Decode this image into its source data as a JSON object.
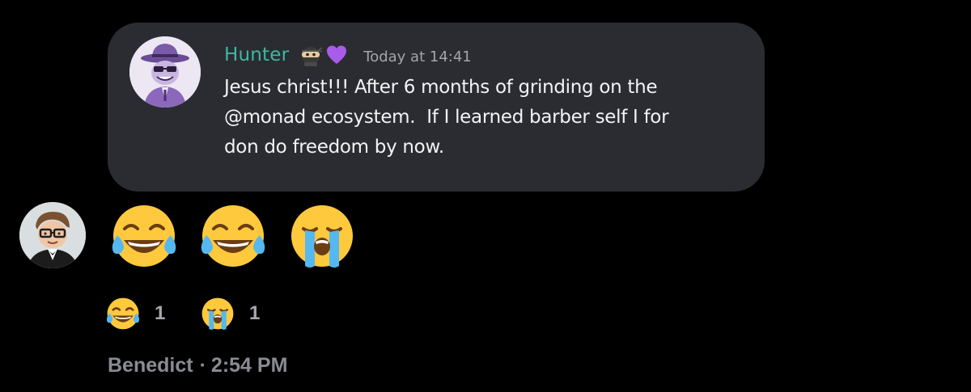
{
  "quoted_message": {
    "author": "Hunter",
    "author_color": "#3fb7a2",
    "badges": [
      "ninja-emoji",
      "purple-heart-emoji"
    ],
    "timestamp": "Today at 14:41",
    "text": "Jesus christ!!! After 6 months of grinding on the\n@monad ecosystem.  If I learned barber self I for\ndon do freedom by now."
  },
  "message": {
    "emojis": [
      "face-with-tears-of-joy",
      "face-with-tears-of-joy",
      "loudly-crying-face"
    ]
  },
  "reactions": [
    {
      "emoji": "face-with-tears-of-joy",
      "count": "1"
    },
    {
      "emoji": "loudly-crying-face",
      "count": "1"
    }
  ],
  "footer": {
    "author": "Benedict",
    "separator": "·",
    "time": "2:54 PM"
  }
}
